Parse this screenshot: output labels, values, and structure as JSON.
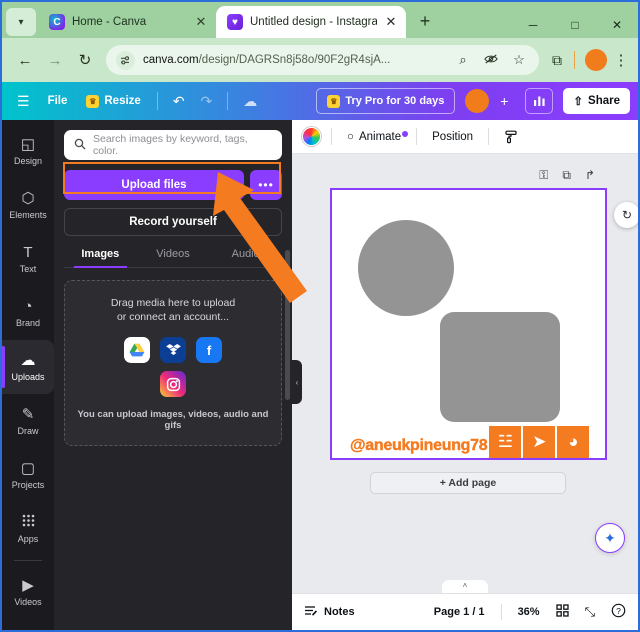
{
  "browser": {
    "tabs": [
      {
        "title": "Home - Canva",
        "favicon": "canva-icon",
        "active": false
      },
      {
        "title": "Untitled design - Instagram",
        "favicon": "canva-design-icon",
        "active": true
      }
    ],
    "newtab_label": "+",
    "window_controls": {
      "minimize": "─",
      "maximize": "□",
      "close": "✕"
    },
    "tab_close_label": "✕",
    "tabs_chevron": "▾",
    "nav": {
      "back": "←",
      "forward": "→",
      "reload": "↻"
    },
    "omnibox": {
      "domain": "canva.com",
      "path": "/design/DAGRSn8j58o/90F2gR4sjA...",
      "site_settings_icon": "tune-icon",
      "zoom_icon": "⌕",
      "incognito_icon": "👁",
      "bookmark_icon": "☆"
    },
    "extensions_icon": "⧉",
    "profile_avatar": "orange-avatar",
    "menu_icon": "⋮"
  },
  "canva_topbar": {
    "menu_icon": "☰",
    "file_label": "File",
    "resize_label": "Resize",
    "crown_icon": "♛",
    "undo_icon": "↶",
    "redo_icon": "↷",
    "cloud_icon": "☁",
    "try_pro_label": "Try Pro for 30 days",
    "plus_label": "+",
    "chart_icon": "▃▇▅",
    "share_label": "Share",
    "share_icon": "⇧"
  },
  "sidebar": {
    "items": [
      {
        "label": "Design",
        "icon": "◱",
        "active": false
      },
      {
        "label": "Elements",
        "icon": "⬡",
        "active": false
      },
      {
        "label": "Text",
        "icon": "T",
        "active": false
      },
      {
        "label": "Brand",
        "icon": "◔",
        "active": false
      },
      {
        "label": "Uploads",
        "icon": "☁",
        "active": true
      },
      {
        "label": "Draw",
        "icon": "✎",
        "active": false
      },
      {
        "label": "Projects",
        "icon": "▢",
        "active": false
      },
      {
        "label": "Apps",
        "icon": "∷",
        "active": false
      },
      {
        "label": "Videos",
        "icon": "▶",
        "active": false
      }
    ]
  },
  "uploads_panel": {
    "search_placeholder": "Search images by keyword, tags, color.",
    "search_icon": "🔍",
    "upload_button": "Upload files",
    "more_button": "•••",
    "record_button": "Record yourself",
    "tabs": [
      {
        "label": "Images",
        "active": true
      },
      {
        "label": "Videos",
        "active": false
      },
      {
        "label": "Audio",
        "active": false
      }
    ],
    "dropzone": {
      "line1": "Drag media here to upload",
      "line2": "or connect an account...",
      "services": [
        {
          "name": "google-drive",
          "glyph": "△"
        },
        {
          "name": "dropbox",
          "glyph": "❖"
        },
        {
          "name": "facebook",
          "glyph": "f"
        },
        {
          "name": "instagram",
          "glyph": "▣"
        }
      ],
      "hint": "You can upload images, videos, audio and gifs"
    },
    "collapse_icon": "‹"
  },
  "editor_toolbar": {
    "color_swatch": "rainbow-wheel",
    "animate_label": "Animate",
    "animate_icon": "○",
    "position_label": "Position",
    "roller_icon": "✇"
  },
  "canvas": {
    "page_tools": [
      {
        "name": "unlock-icon",
        "glyph": "⚿"
      },
      {
        "name": "duplicate-icon",
        "glyph": "⧉"
      },
      {
        "name": "add-page-icon",
        "glyph": "↱"
      }
    ],
    "rotate_icon": "↻",
    "add_page_label": "+ Add page",
    "magic_icon": "✦",
    "watermark": {
      "text": "@aneukpineung78",
      "tiles": [
        {
          "name": "steemit-icon",
          "glyph": "☳"
        },
        {
          "name": "telegram-icon",
          "glyph": "➤"
        },
        {
          "name": "discord-icon",
          "glyph": "◕"
        }
      ]
    }
  },
  "bottombar": {
    "notes_label": "Notes",
    "notes_icon": "☰",
    "page_label": "Page 1 / 1",
    "zoom_label": "36%",
    "grid_icon": "▦",
    "expand_icon": "⤡",
    "help_icon": "?",
    "page_pill": "˄"
  },
  "annotation": {
    "highlight_color": "#f47b20",
    "arrow_color": "#f47b20",
    "arrow_target": "upload-files-button"
  }
}
